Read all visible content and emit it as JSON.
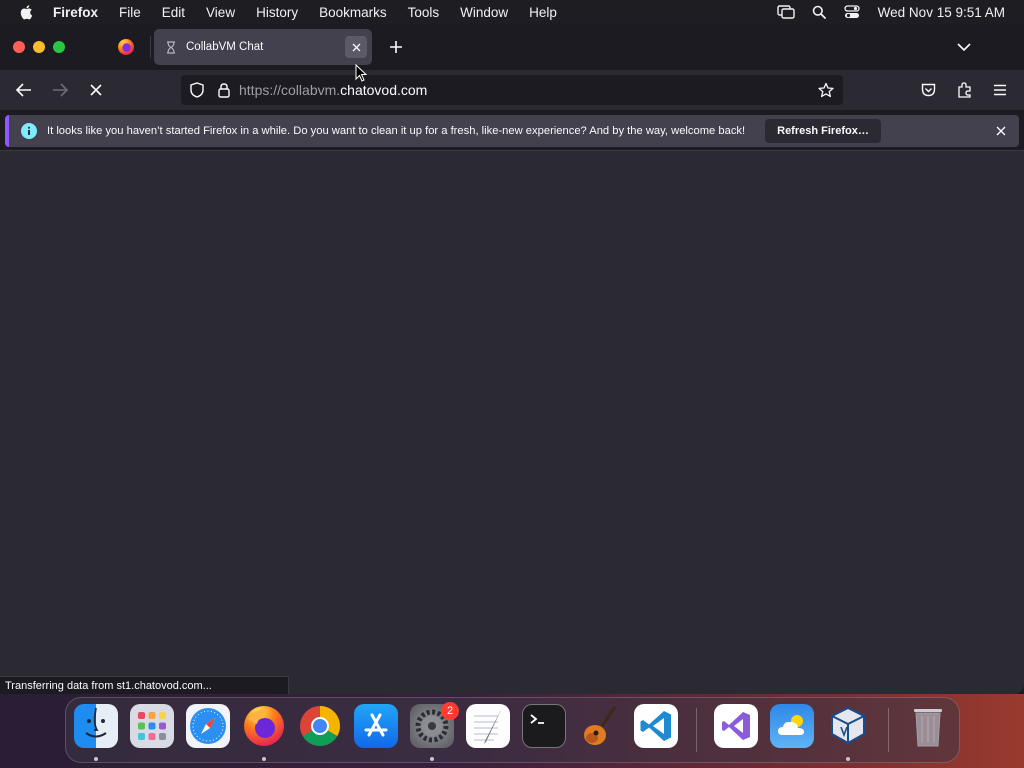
{
  "menubar": {
    "app_name": "Firefox",
    "items": [
      "File",
      "Edit",
      "View",
      "History",
      "Bookmarks",
      "Tools",
      "Window",
      "Help"
    ],
    "clock": "Wed Nov 15  9:51 AM"
  },
  "tabs": {
    "active": {
      "title": "CollabVM Chat",
      "icon": "hourglass-icon"
    },
    "pinned_icon": "firefox-icon"
  },
  "navbar": {
    "url_prefix": "https://collabvm.",
    "url_host": "chatovod.com"
  },
  "notification": {
    "message": "It looks like you haven’t started Firefox in a while. Do you want to clean it up for a fresh, like-new experience? And by the way, welcome back!",
    "button_label": "Refresh Firefox…"
  },
  "status_text": "Transferring data from st1.chatovod.com...",
  "dock": {
    "apps": [
      "Finder",
      "Launchpad",
      "Safari",
      "Firefox",
      "Chrome",
      "App Store",
      "System Settings",
      "TextEdit",
      "Terminal",
      "GarageBand",
      "Visual Studio Code",
      "Visual Studio",
      "Weather",
      "VirtualBox",
      "Trash"
    ],
    "settings_badge": "2"
  },
  "colors": {
    "accent": "#9059ff",
    "info": "#80ebff",
    "toolbar": "#2b2a33",
    "chrome": "#1c1b22"
  }
}
